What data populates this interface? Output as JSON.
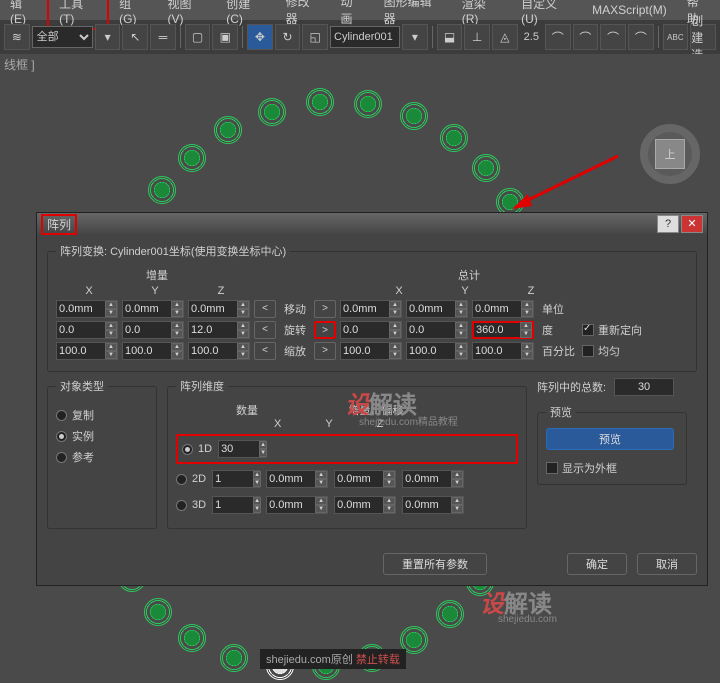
{
  "menu": {
    "edit": "辑(E)",
    "tools": "工具(T)",
    "group": "组(G)",
    "views": "视图(V)",
    "create": "创建(C)",
    "modifiers": "修改器",
    "animation": "动画",
    "graph": "图形编辑器",
    "rendering": "渲染(R)",
    "customize": "自定义(U)",
    "maxscript": "MAXScript(M)",
    "help": "帮助"
  },
  "toolbar": {
    "set_all": "全部",
    "object_name": "Cylinder001",
    "grid_value": "2.5"
  },
  "viewport": {
    "label": "线框 ]",
    "viewcube": "上"
  },
  "dialog": {
    "title": "阵列",
    "transform_legend": "阵列变换: Cylinder001坐标(使用变换坐标中心)",
    "incr": "增量",
    "total": "总计",
    "axes": {
      "x": "X",
      "y": "Y",
      "z": "Z"
    },
    "move": {
      "label": "移动",
      "ix": "0.0mm",
      "iy": "0.0mm",
      "iz": "0.0mm",
      "tx": "0.0mm",
      "ty": "0.0mm",
      "tz": "0.0mm",
      "unit": "单位"
    },
    "rotate": {
      "label": "旋转",
      "ix": "0.0",
      "iy": "0.0",
      "iz": "12.0",
      "tx": "0.0",
      "ty": "0.0",
      "tz": "360.0",
      "unit": "度",
      "reorient": "重新定向"
    },
    "scale": {
      "label": "缩放",
      "ix": "100.0",
      "iy": "100.0",
      "iz": "100.0",
      "tx": "100.0",
      "ty": "100.0",
      "tz": "100.0",
      "unit": "百分比",
      "uniform": "均匀"
    },
    "obj_type": {
      "legend": "对象类型",
      "copy": "复制",
      "instance": "实例",
      "reference": "参考"
    },
    "dim": {
      "legend": "阵列维度",
      "count": "数量",
      "d1": "1D",
      "d2": "2D",
      "d3": "3D",
      "c1": "30",
      "c2": "1",
      "c3": "1",
      "row_offset": "增量行偏移",
      "x2": "0.0mm",
      "y2": "0.0mm",
      "z2": "0.0mm",
      "x3": "0.0mm",
      "y3": "0.0mm",
      "z3": "0.0mm"
    },
    "arr_total": {
      "label": "阵列中的总数:",
      "value": "30"
    },
    "preview": {
      "legend": "预览",
      "btn": "预览",
      "wire": "显示为外框"
    },
    "reset": "重置所有参数",
    "ok": "确定",
    "cancel": "取消"
  },
  "watermark": {
    "a": "设",
    "b": "解读",
    "sub": "shejiedu.com",
    "sub2": "精品教程",
    "footer1": "shejiedu.com原创",
    "footer2": "禁止转载"
  }
}
